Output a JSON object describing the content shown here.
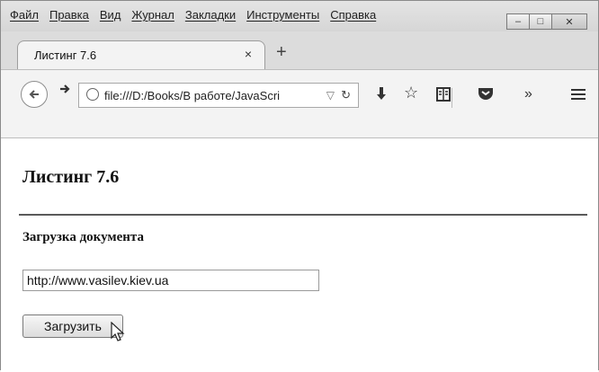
{
  "menu": {
    "items": [
      "Файл",
      "Правка",
      "Вид",
      "Журнал",
      "Закладки",
      "Инструменты",
      "Справка"
    ]
  },
  "window_controls": {
    "minimize": "–",
    "maximize": "□",
    "close": "✕"
  },
  "tab": {
    "title": "Листинг 7.6",
    "close": "×",
    "new_tab": "+"
  },
  "navbar": {
    "url": "file:///D:/Books/В работе/JavaScri",
    "icons": [
      "back-icon",
      "forward-icon",
      "globe-icon",
      "dropdown-icon",
      "reload-icon",
      "download-icon",
      "bookmark-star-icon",
      "reading-list-icon",
      "pocket-icon",
      "overflow-icon",
      "menu-icon"
    ]
  },
  "page": {
    "title": "Листинг 7.6",
    "subheading": "Загрузка документа",
    "url_input_value": "http://www.vasilev.kiev.ua",
    "load_button_label": "Загрузить"
  }
}
